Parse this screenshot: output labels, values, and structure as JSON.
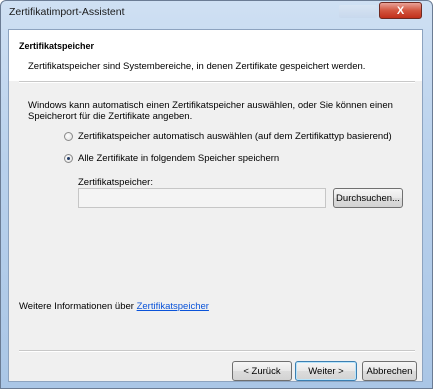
{
  "window": {
    "title": "Zertifikatimport-Assistent",
    "close_glyph": "X"
  },
  "header": {
    "title": "Zertifikatspeicher",
    "description": "Zertifikatspeicher sind Systembereiche, in denen Zertifikate gespeichert werden."
  },
  "body": {
    "intro": "Windows kann automatisch einen Zertifikatspeicher auswählen, oder Sie können einen Speicherort für die Zertifikate angeben.",
    "options": [
      {
        "label": "Zertifikatspeicher automatisch auswählen (auf dem Zertifikattyp basierend)",
        "selected": false
      },
      {
        "label": "Alle Zertifikate in folgendem Speicher speichern",
        "selected": true
      }
    ],
    "store_label": "Zertifikatspeicher:",
    "store_value": "",
    "browse_label": "Durchsuchen..."
  },
  "more_info": {
    "prefix": "Weitere Informationen über ",
    "link": "Zertifikatspeicher"
  },
  "footer": {
    "back_label": "< Zurück",
    "next_label": "Weiter >",
    "cancel_label": "Abbrechen"
  }
}
